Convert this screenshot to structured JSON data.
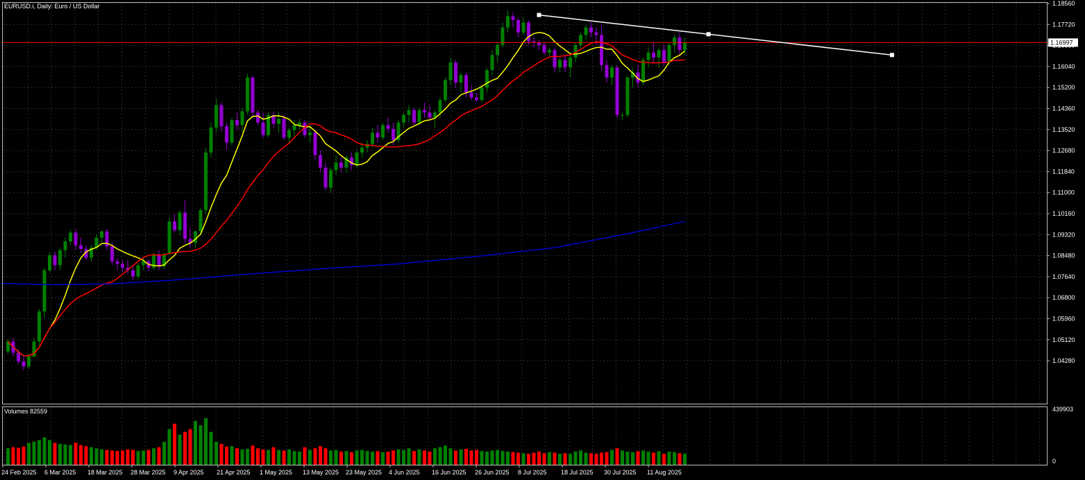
{
  "symbol_header": "EURUSD.i, Daily:  Euro / US Dollar",
  "volume_header": "Volumes 82559",
  "colors": {
    "background": "#000000",
    "grid": "#2b2b2b",
    "frame": "#c0c0c0",
    "bull": "#008000",
    "bear": "#9400d3",
    "vol_up": "#008000",
    "vol_down": "#ff0000",
    "ma_fast": "#ffff00",
    "ma_mid": "#ff0000",
    "ma_slow": "#0000cd",
    "trendline": "#ffffff",
    "current_price_line": "#ff0000",
    "price_tag_bg": "#ffffff",
    "price_tag_text": "#000000"
  },
  "chart_data": {
    "type": "candlestick",
    "y_axis_labels": [
      "1.18560",
      "1.17720",
      "1.16880",
      "1.16040",
      "1.15200",
      "1.14360",
      "1.13520",
      "1.12680",
      "1.11840",
      "1.11000",
      "1.10160",
      "1.09320",
      "1.08480",
      "1.07640",
      "1.06800",
      "1.05960",
      "1.05120",
      "1.04280"
    ],
    "y_range": [
      1.0375,
      1.1895
    ],
    "current_price": 1.16997,
    "current_price_label": "1.16997",
    "volume_axis_labels": [
      "439903",
      "0"
    ],
    "volume_max": 439903,
    "x_labels": [
      "24 Feb 2025",
      "6 Mar 2025",
      "18 Mar 2025",
      "28 Mar 2025",
      "9 Apr 2025",
      "21 Apr 2025",
      "1 May 2025",
      "13 May 2025",
      "23 May 2025",
      "4 Jun 2025",
      "16 Jun 2025",
      "26 Jun 2025",
      "8 Jul 2025",
      "18 Jul 2025",
      "30 Jul 2025",
      "11 Aug 2025"
    ],
    "candles": [
      [
        1.0465,
        1.0515,
        1.0455,
        1.0505
      ],
      [
        1.0505,
        1.052,
        1.0445,
        1.046
      ],
      [
        1.046,
        1.0475,
        1.0415,
        1.0425
      ],
      [
        1.0425,
        1.0445,
        1.039,
        1.0405
      ],
      [
        1.0405,
        1.0455,
        1.0395,
        1.0445
      ],
      [
        1.0445,
        1.052,
        1.044,
        1.0505
      ],
      [
        1.0505,
        1.0635,
        1.049,
        1.0625
      ],
      [
        1.0625,
        1.08,
        1.06,
        1.079
      ],
      [
        1.079,
        1.086,
        1.078,
        1.085
      ],
      [
        1.085,
        1.0865,
        1.079,
        1.081
      ],
      [
        1.081,
        1.088,
        1.079,
        1.087
      ],
      [
        1.087,
        1.092,
        1.084,
        1.0905
      ],
      [
        1.0905,
        1.095,
        1.089,
        1.094
      ],
      [
        1.094,
        1.0955,
        1.087,
        1.089
      ],
      [
        1.089,
        1.092,
        1.086,
        1.0875
      ],
      [
        1.0875,
        1.089,
        1.083,
        1.084
      ],
      [
        1.084,
        1.089,
        1.0825,
        1.088
      ],
      [
        1.088,
        1.0935,
        1.087,
        1.092
      ],
      [
        1.092,
        1.095,
        1.09,
        1.0945
      ],
      [
        1.0945,
        1.0955,
        1.087,
        1.0885
      ],
      [
        1.0885,
        1.09,
        1.081,
        1.0825
      ],
      [
        1.0825,
        1.084,
        1.079,
        1.0815
      ],
      [
        1.0815,
        1.083,
        1.078,
        1.08
      ],
      [
        1.08,
        1.083,
        1.0775,
        1.079
      ],
      [
        1.079,
        1.081,
        1.075,
        1.0765
      ],
      [
        1.0765,
        1.082,
        1.0755,
        1.081
      ],
      [
        1.081,
        1.084,
        1.079,
        1.0825
      ],
      [
        1.0825,
        1.0835,
        1.0785,
        1.08
      ],
      [
        1.08,
        1.086,
        1.079,
        1.085
      ],
      [
        1.085,
        1.087,
        1.079,
        1.0805
      ],
      [
        1.0805,
        1.086,
        1.0795,
        1.0855
      ],
      [
        1.0855,
        1.1,
        1.085,
        1.0985
      ],
      [
        1.0985,
        1.1015,
        1.094,
        1.095
      ],
      [
        1.095,
        1.103,
        1.093,
        1.102
      ],
      [
        1.102,
        1.107,
        1.09,
        1.0915
      ],
      [
        1.0915,
        1.096,
        1.088,
        1.09
      ],
      [
        1.09,
        1.095,
        1.088,
        1.0945
      ],
      [
        1.0945,
        1.104,
        1.093,
        1.103
      ],
      [
        1.103,
        1.128,
        1.101,
        1.126
      ],
      [
        1.126,
        1.138,
        1.124,
        1.136
      ],
      [
        1.136,
        1.1475,
        1.134,
        1.145
      ],
      [
        1.145,
        1.146,
        1.1345,
        1.1365
      ],
      [
        1.1365,
        1.138,
        1.127,
        1.13
      ],
      [
        1.13,
        1.14,
        1.129,
        1.139
      ],
      [
        1.139,
        1.142,
        1.135,
        1.137
      ],
      [
        1.137,
        1.144,
        1.134,
        1.1425
      ],
      [
        1.1425,
        1.1575,
        1.141,
        1.156
      ],
      [
        1.156,
        1.157,
        1.14,
        1.142
      ],
      [
        1.142,
        1.143,
        1.137,
        1.138
      ],
      [
        1.138,
        1.142,
        1.132,
        1.133
      ],
      [
        1.133,
        1.142,
        1.132,
        1.141
      ],
      [
        1.141,
        1.1425,
        1.136,
        1.1375
      ],
      [
        1.1375,
        1.142,
        1.134,
        1.1395
      ],
      [
        1.1395,
        1.141,
        1.131,
        1.132
      ],
      [
        1.132,
        1.136,
        1.13,
        1.135
      ],
      [
        1.135,
        1.139,
        1.132,
        1.137
      ],
      [
        1.137,
        1.1395,
        1.135,
        1.138
      ],
      [
        1.138,
        1.139,
        1.132,
        1.133
      ],
      [
        1.133,
        1.137,
        1.13,
        1.134
      ],
      [
        1.134,
        1.135,
        1.123,
        1.125
      ],
      [
        1.125,
        1.127,
        1.118,
        1.12
      ],
      [
        1.12,
        1.122,
        1.111,
        1.112
      ],
      [
        1.112,
        1.12,
        1.11,
        1.119
      ],
      [
        1.119,
        1.125,
        1.117,
        1.122
      ],
      [
        1.122,
        1.124,
        1.118,
        1.12
      ],
      [
        1.12,
        1.125,
        1.118,
        1.124
      ],
      [
        1.124,
        1.126,
        1.119,
        1.121
      ],
      [
        1.121,
        1.127,
        1.12,
        1.126
      ],
      [
        1.126,
        1.13,
        1.124,
        1.128
      ],
      [
        1.128,
        1.131,
        1.126,
        1.1295
      ],
      [
        1.1295,
        1.136,
        1.128,
        1.134
      ],
      [
        1.134,
        1.137,
        1.13,
        1.132
      ],
      [
        1.132,
        1.138,
        1.131,
        1.137
      ],
      [
        1.137,
        1.14,
        1.134,
        1.1355
      ],
      [
        1.1355,
        1.138,
        1.129,
        1.131
      ],
      [
        1.131,
        1.139,
        1.13,
        1.138
      ],
      [
        1.138,
        1.142,
        1.136,
        1.141
      ],
      [
        1.141,
        1.145,
        1.138,
        1.143
      ],
      [
        1.143,
        1.144,
        1.137,
        1.138
      ],
      [
        1.138,
        1.144,
        1.137,
        1.143
      ],
      [
        1.143,
        1.146,
        1.14,
        1.142
      ],
      [
        1.142,
        1.145,
        1.139,
        1.14
      ],
      [
        1.14,
        1.143,
        1.136,
        1.142
      ],
      [
        1.142,
        1.148,
        1.14,
        1.147
      ],
      [
        1.147,
        1.156,
        1.146,
        1.155
      ],
      [
        1.155,
        1.164,
        1.153,
        1.162
      ],
      [
        1.162,
        1.163,
        1.152,
        1.154
      ],
      [
        1.154,
        1.158,
        1.15,
        1.157
      ],
      [
        1.157,
        1.158,
        1.148,
        1.15
      ],
      [
        1.15,
        1.153,
        1.147,
        1.148
      ],
      [
        1.148,
        1.15,
        1.146,
        1.147
      ],
      [
        1.147,
        1.153,
        1.146,
        1.152
      ],
      [
        1.152,
        1.16,
        1.15,
        1.159
      ],
      [
        1.159,
        1.167,
        1.157,
        1.165
      ],
      [
        1.165,
        1.17,
        1.162,
        1.169
      ],
      [
        1.169,
        1.178,
        1.168,
        1.176
      ],
      [
        1.176,
        1.183,
        1.174,
        1.1805
      ],
      [
        1.1805,
        1.182,
        1.176,
        1.179
      ],
      [
        1.179,
        1.18,
        1.172,
        1.174
      ],
      [
        1.174,
        1.18,
        1.173,
        1.178
      ],
      [
        1.178,
        1.179,
        1.169,
        1.1705
      ],
      [
        1.1705,
        1.172,
        1.168,
        1.17
      ],
      [
        1.17,
        1.171,
        1.167,
        1.169
      ],
      [
        1.169,
        1.17,
        1.165,
        1.166
      ],
      [
        1.166,
        1.168,
        1.164,
        1.167
      ],
      [
        1.167,
        1.168,
        1.158,
        1.16
      ],
      [
        1.16,
        1.164,
        1.158,
        1.163
      ],
      [
        1.163,
        1.165,
        1.158,
        1.16
      ],
      [
        1.16,
        1.165,
        1.156,
        1.164
      ],
      [
        1.164,
        1.17,
        1.162,
        1.169
      ],
      [
        1.169,
        1.174,
        1.167,
        1.173
      ],
      [
        1.173,
        1.177,
        1.171,
        1.176
      ],
      [
        1.176,
        1.178,
        1.172,
        1.174
      ],
      [
        1.174,
        1.176,
        1.169,
        1.173
      ],
      [
        1.173,
        1.177,
        1.159,
        1.161
      ],
      [
        1.161,
        1.163,
        1.154,
        1.156
      ],
      [
        1.156,
        1.161,
        1.153,
        1.16
      ],
      [
        1.16,
        1.161,
        1.14,
        1.141
      ],
      [
        1.141,
        1.142,
        1.139,
        1.141
      ],
      [
        1.141,
        1.157,
        1.14,
        1.156
      ],
      [
        1.156,
        1.16,
        1.152,
        1.158
      ],
      [
        1.158,
        1.161,
        1.152,
        1.154
      ],
      [
        1.154,
        1.164,
        1.153,
        1.163
      ],
      [
        1.163,
        1.168,
        1.16,
        1.166
      ],
      [
        1.166,
        1.17,
        1.162,
        1.164
      ],
      [
        1.164,
        1.168,
        1.16,
        1.167
      ],
      [
        1.167,
        1.169,
        1.161,
        1.162
      ],
      [
        1.162,
        1.17,
        1.161,
        1.169
      ],
      [
        1.169,
        1.173,
        1.166,
        1.172
      ],
      [
        1.172,
        1.174,
        1.165,
        1.167
      ],
      [
        1.167,
        1.172,
        1.165,
        1.17
      ]
    ],
    "volumes": [
      0.3,
      0.32,
      0.31,
      0.33,
      0.4,
      0.42,
      0.45,
      0.5,
      0.45,
      0.4,
      0.38,
      0.37,
      0.36,
      0.4,
      0.36,
      0.34,
      0.32,
      0.3,
      0.28,
      0.27,
      0.26,
      0.25,
      0.26,
      0.28,
      0.27,
      0.25,
      0.26,
      0.27,
      0.3,
      0.32,
      0.42,
      0.65,
      0.75,
      0.55,
      0.6,
      0.65,
      0.8,
      0.72,
      0.85,
      0.6,
      0.42,
      0.38,
      0.33,
      0.34,
      0.3,
      0.28,
      0.29,
      0.35,
      0.3,
      0.28,
      0.27,
      0.32,
      0.27,
      0.26,
      0.28,
      0.25,
      0.24,
      0.32,
      0.27,
      0.3,
      0.34,
      0.3,
      0.26,
      0.27,
      0.24,
      0.25,
      0.23,
      0.26,
      0.27,
      0.25,
      0.24,
      0.25,
      0.23,
      0.24,
      0.26,
      0.28,
      0.27,
      0.3,
      0.25,
      0.28,
      0.26,
      0.24,
      0.3,
      0.32,
      0.35,
      0.3,
      0.26,
      0.28,
      0.29,
      0.26,
      0.27,
      0.25,
      0.24,
      0.26,
      0.27,
      0.25,
      0.24,
      0.23,
      0.22,
      0.21,
      0.2,
      0.22,
      0.24,
      0.21,
      0.23,
      0.22,
      0.2,
      0.21,
      0.2,
      0.24,
      0.26,
      0.22,
      0.21,
      0.2,
      0.22,
      0.23,
      0.27,
      0.3,
      0.26,
      0.24,
      0.23,
      0.25,
      0.26,
      0.24,
      0.22,
      0.25,
      0.2,
      0.24,
      0.23,
      0.21,
      0.2
    ],
    "ma_slow": [
      [
        0,
        1.0737
      ],
      [
        8,
        1.0732
      ],
      [
        20,
        1.0735
      ],
      [
        35,
        1.0755
      ],
      [
        45,
        1.0773
      ],
      [
        60,
        1.0795
      ],
      [
        75,
        1.0815
      ],
      [
        90,
        1.0845
      ],
      [
        105,
        1.088
      ],
      [
        120,
        1.094
      ],
      [
        130,
        1.0985
      ]
    ],
    "trendline": {
      "start": [
        102,
        1.181
      ],
      "end": [
        169,
        1.171
      ],
      "end_marker_x": 169.8
    },
    "trendline_end_marker": [
      169.8,
      1.165
    ]
  }
}
